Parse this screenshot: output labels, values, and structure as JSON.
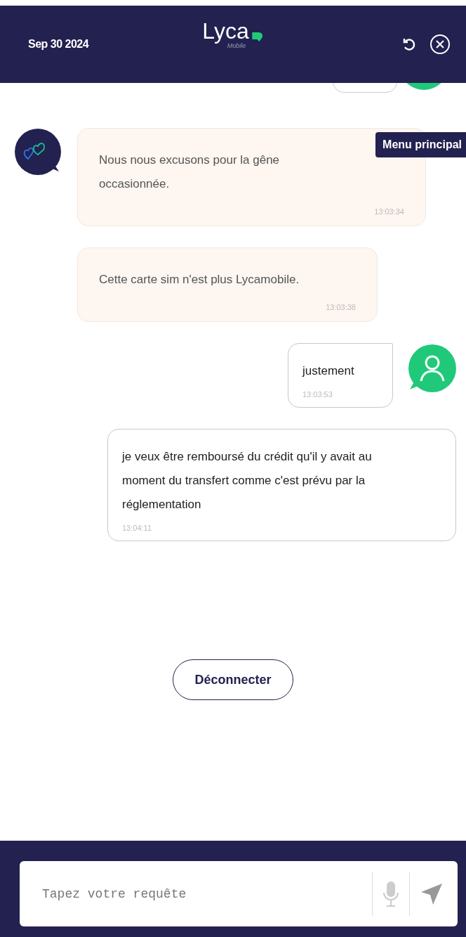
{
  "header": {
    "date": "Sep 30 2024",
    "logo": {
      "brand": "Lyca",
      "sub": "Mobile"
    }
  },
  "tooltip": "Menu principal",
  "messages": [
    {
      "kind": "bot",
      "avatar": true,
      "text": "Nous nous excusons pour la gêne occasionnée.",
      "time": "13:03:34"
    },
    {
      "kind": "bot",
      "avatar": false,
      "text": "Cette  carte  sim n'est plus  Lycamobile.",
      "time": "13:03:38"
    },
    {
      "kind": "user",
      "avatar": true,
      "text": "justement",
      "time": "13:03:53"
    },
    {
      "kind": "user",
      "avatar": false,
      "text": "je veux être remboursé du crédit qu'il y avait au moment du transfert comme c'est prévu par la réglementation",
      "time": "13:04:11"
    }
  ],
  "disconnect_button": "Déconnecter",
  "composer": {
    "placeholder": "Tapez votre requête"
  }
}
